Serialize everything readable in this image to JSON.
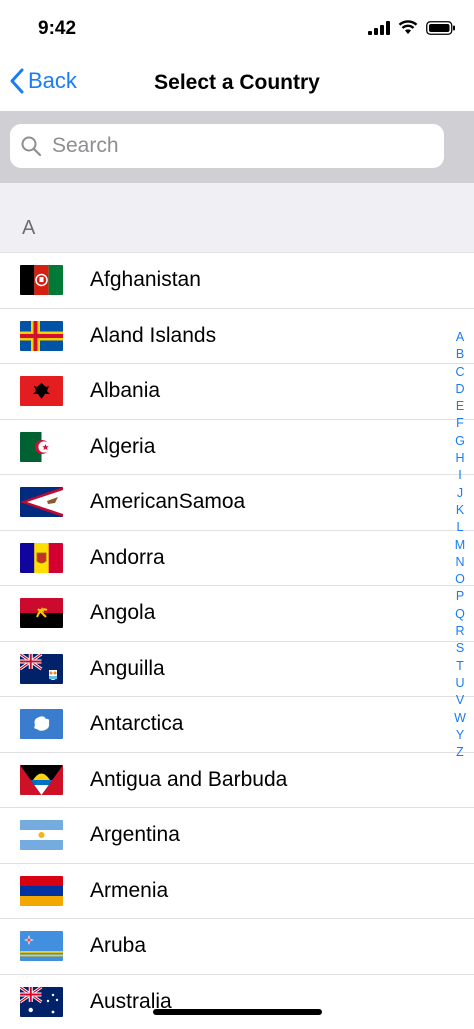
{
  "status": {
    "time": "9:42"
  },
  "nav": {
    "back_label": "Back",
    "title": "Select a Country"
  },
  "search": {
    "placeholder": "Search"
  },
  "section": {
    "letter": "A"
  },
  "countries": [
    {
      "name": "Afghanistan",
      "flag": "afghanistan-flag-icon"
    },
    {
      "name": "Aland Islands",
      "flag": "aland-islands-flag-icon"
    },
    {
      "name": "Albania",
      "flag": "albania-flag-icon"
    },
    {
      "name": "Algeria",
      "flag": "algeria-flag-icon"
    },
    {
      "name": "AmericanSamoa",
      "flag": "american-samoa-flag-icon"
    },
    {
      "name": "Andorra",
      "flag": "andorra-flag-icon"
    },
    {
      "name": "Angola",
      "flag": "angola-flag-icon"
    },
    {
      "name": "Anguilla",
      "flag": "anguilla-flag-icon"
    },
    {
      "name": "Antarctica",
      "flag": "antarctica-flag-icon"
    },
    {
      "name": "Antigua and Barbuda",
      "flag": "antigua-and-barbuda-flag-icon"
    },
    {
      "name": "Argentina",
      "flag": "argentina-flag-icon"
    },
    {
      "name": "Armenia",
      "flag": "armenia-flag-icon"
    },
    {
      "name": "Aruba",
      "flag": "aruba-flag-icon"
    },
    {
      "name": "Australia",
      "flag": "australia-flag-icon"
    }
  ],
  "index_letters": [
    "A",
    "B",
    "C",
    "D",
    "E",
    "F",
    "G",
    "H",
    "I",
    "J",
    "K",
    "L",
    "M",
    "N",
    "O",
    "P",
    "Q",
    "R",
    "S",
    "T",
    "U",
    "V",
    "W",
    "Y",
    "Z"
  ],
  "colors": {
    "accent": "#1a7cf5",
    "search_bg": "#d0d0d4",
    "section_bg": "#efeff4"
  }
}
